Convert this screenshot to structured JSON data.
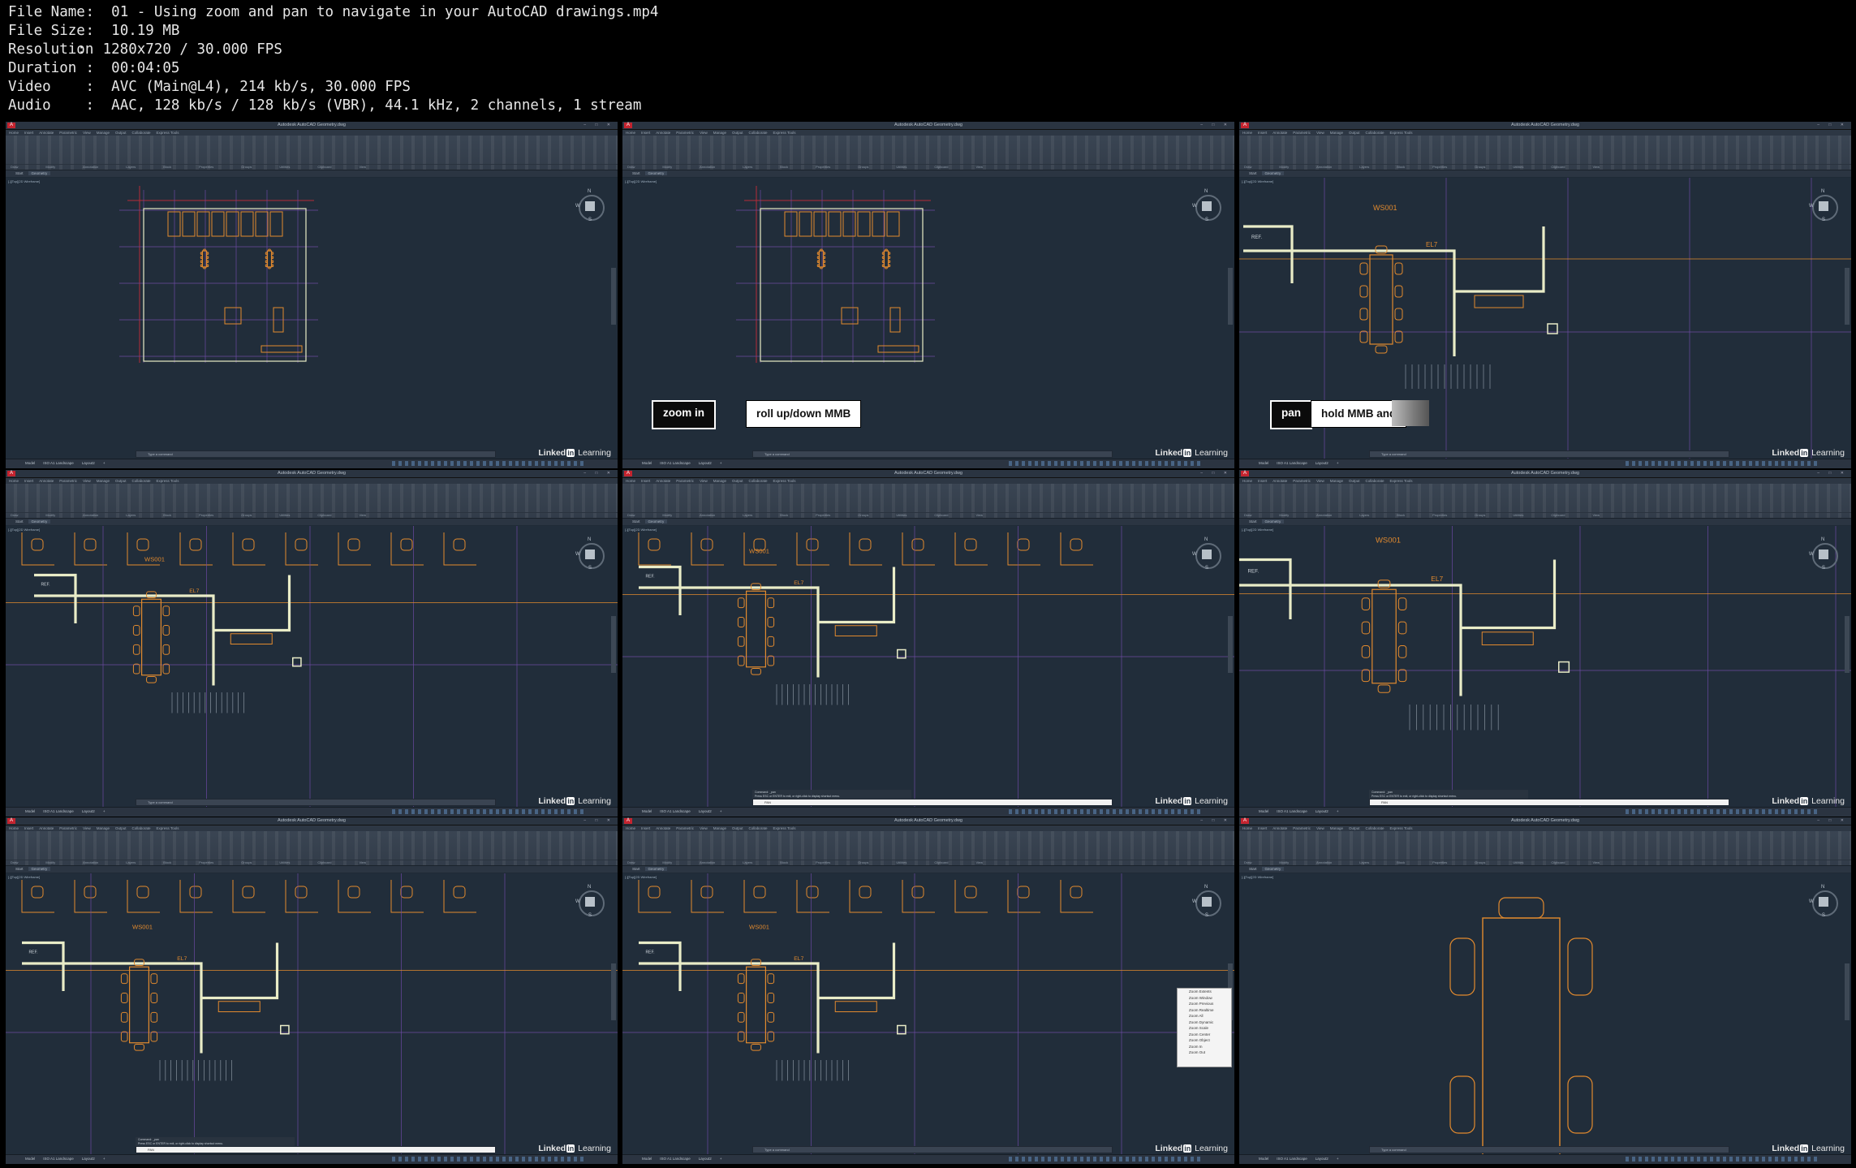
{
  "file_info": [
    {
      "key": "File Name",
      "sep": " :  ",
      "value": "01 - Using zoom and pan to navigate in your AutoCAD drawings.mp4"
    },
    {
      "key": "File Size",
      "sep": " :  ",
      "value": "10.19 MB"
    },
    {
      "key": "Resolution",
      "sep": ":  ",
      "value": "1280x720 / 30.000 FPS"
    },
    {
      "key": "Duration",
      "sep": " :  ",
      "value": "00:04:05"
    },
    {
      "key": "Video",
      "sep": " :  ",
      "value": "AVC (Main@L4), 214 kb/s, 30.000 FPS"
    },
    {
      "key": "Audio",
      "sep": " :  ",
      "value": "AAC, 128 kb/s / 128 kb/s (VBR), 44.1 kHz, 2 channels, 1 stream"
    }
  ],
  "app": {
    "logo": "A",
    "title": "Autodesk AutoCAD  Geometry.dwg",
    "menu_tabs": [
      "Home",
      "Insert",
      "Annotate",
      "Parametric",
      "View",
      "Manage",
      "Output",
      "Collaborate",
      "Express Tools"
    ],
    "ribbon_groups": [
      "Draw",
      "Modify",
      "Annotation",
      "Layers",
      "Block",
      "Properties",
      "Groups",
      "Utilities",
      "Clipboard",
      "View"
    ],
    "doc_tabs": [
      "Start",
      "Geometry"
    ],
    "viewport_label": "[-][Top][2D Wireframe]",
    "layout_tabs": [
      "Model",
      "ISO A1 Landscape",
      "Layout2",
      "+"
    ],
    "command_placeholder": "Type a command",
    "command_history": [
      "Command: _pan",
      "Press ESC or ENTER to exit, or right-click to display shortcut menu."
    ],
    "command_typed": "PAN",
    "viewcube": {
      "n": "N",
      "w": "W",
      "s": "S"
    }
  },
  "brand": {
    "text1": "Linked",
    "text2": "in",
    "text3": " Learning"
  },
  "captions": {
    "frame2": [
      "zoom in",
      "roll up/down MMB"
    ],
    "frame3": [
      "pan",
      "hold MMB and"
    ]
  },
  "plan_labels": {
    "ws": "WS001",
    "el": "EL7",
    "ref": "REF."
  },
  "zoom_menu": [
    "Zoom Extents",
    "Zoom Window",
    "Zoom Previous",
    "Zoom Realtime",
    "Zoom All",
    "Zoom Dynamic",
    "Zoom Scale",
    "Zoom Center",
    "Zoom Object",
    "Zoom In",
    "Zoom Out"
  ],
  "colors": {
    "canvas": "#212d3a",
    "wall": "#e9ecc7",
    "furniture": "#e28a2e",
    "gridline": "#6c4aa2",
    "redline": "#b52a38",
    "brand_orange": "#e28a2e"
  }
}
